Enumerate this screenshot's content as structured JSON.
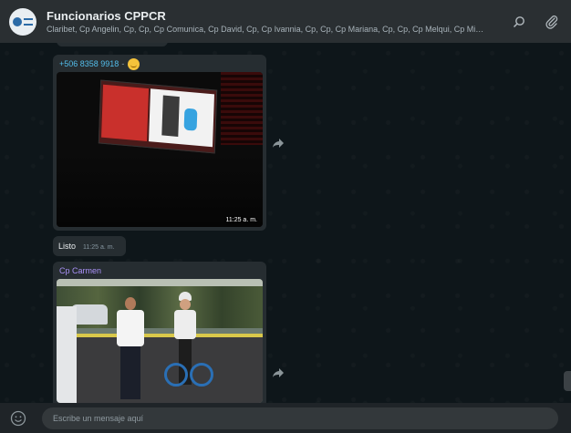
{
  "header": {
    "title": "Funcionarios CPPCR",
    "subtitle": "Claribet, Cp Angelin, Cp, Cp, Cp Comunica, Cp David, Cp, Cp Ivannia, Cp, Cp, Cp Mariana, Cp, Cp, Cp Melqui, Cp Miriam, C...",
    "icons": [
      "search-icon",
      "paperclip-icon"
    ]
  },
  "messages": [
    {
      "sender": "+506 8358 9918",
      "sender_suffix": "-",
      "sender_color": "#53bdeb",
      "type": "image",
      "time": "11:25 a. m."
    },
    {
      "type": "text",
      "text": "Listo",
      "time": "11:25 a. m."
    },
    {
      "sender": "Cp Carmen",
      "sender_color": "#a991f7",
      "type": "image"
    }
  ],
  "composer": {
    "placeholder": "Escribe un mensaje aquí"
  },
  "colors": {
    "header_bg": "#2a2f32",
    "bubble_bg": "#262d31",
    "chat_bg": "#0e161a"
  }
}
